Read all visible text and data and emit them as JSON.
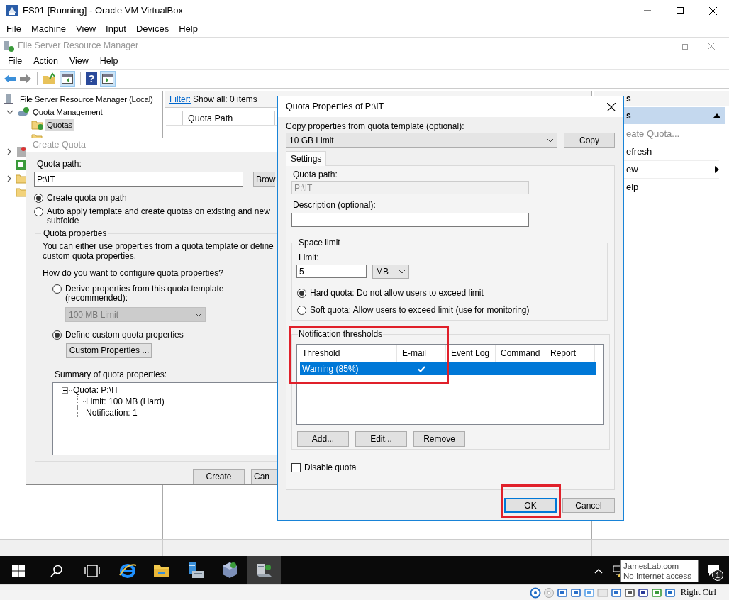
{
  "vbox": {
    "title": "FS01 [Running] - Oracle VM VirtualBox",
    "menu": [
      "File",
      "Machine",
      "View",
      "Input",
      "Devices",
      "Help"
    ],
    "host_key": "Right Ctrl"
  },
  "fsrm": {
    "title": "File Server Resource Manager",
    "menu": [
      "File",
      "Action",
      "View",
      "Help"
    ],
    "help_glyph": "?",
    "tree": [
      {
        "label": "File Server Resource Manager (Local)",
        "selected": false,
        "children": [
          {
            "label": "Quota Management",
            "expanded": true,
            "selected": false,
            "children": [
              {
                "label": "Quotas",
                "selected": true
              }
            ]
          }
        ]
      }
    ],
    "filter": {
      "link": "Filter:",
      "text": "Show all: 0 items"
    },
    "columns": [
      "Quota Path"
    ],
    "actions": {
      "header": "s",
      "section": "s",
      "items": [
        {
          "label": "eate Quota...",
          "disabled": true,
          "submenu": false
        },
        {
          "label": "efresh",
          "disabled": false,
          "submenu": false
        },
        {
          "label": "ew",
          "disabled": false,
          "submenu": true
        },
        {
          "label": "elp",
          "disabled": false,
          "submenu": false
        }
      ]
    }
  },
  "create_quota": {
    "title": "Create Quota",
    "path_label": "Quota path:",
    "path": "P:\\IT",
    "browse": "Brow",
    "modes": [
      {
        "label": "Create quota on path",
        "selected": true
      },
      {
        "label": "Auto apply template and create quotas on existing and new subfolde",
        "selected": false
      }
    ],
    "group": "Quota properties",
    "intro": "You can either use properties from a quota template or define custom quota properties.",
    "question": "How do you want to configure quota properties?",
    "sources": [
      {
        "label": "Derive properties from this quota template (recommended):",
        "selected": false
      },
      {
        "label": "Define custom quota properties",
        "selected": true
      }
    ],
    "template": "100 MB Limit",
    "template_disabled": true,
    "custom_button": "Custom Properties ...",
    "summary_label": "Summary of quota properties:",
    "summary": {
      "label": "Quota: P:\\IT",
      "expanded": true,
      "children": [
        "Limit: 100 MB (Hard)",
        "Notification: 1"
      ]
    },
    "buttons": [
      "Create",
      "Can"
    ]
  },
  "quota_properties": {
    "title": "Quota Properties of P:\\IT",
    "copy_label": "Copy properties from quota template (optional):",
    "template": "10 GB Limit",
    "copy_button": "Copy",
    "tabs": [
      {
        "label": "Settings",
        "selected": true
      }
    ],
    "path_label": "Quota path:",
    "path": "P:\\IT",
    "description_label": "Description (optional):",
    "space_group": "Space limit",
    "limit_label": "Limit:",
    "limit": "5",
    "unit": "MB",
    "limit_types": [
      {
        "label": "Hard quota: Do not allow users to exceed limit",
        "selected": true
      },
      {
        "label": "Soft quota: Allow users to exceed limit (use for monitoring)",
        "selected": false
      }
    ],
    "notify_group": "Notification thresholds",
    "columns": [
      "Threshold",
      "E-mail",
      "Event Log",
      "Command",
      "Report"
    ],
    "thresholds": [
      {
        "threshold": "Warning (85%)",
        "email": true,
        "event_log": false,
        "command": false,
        "report": false,
        "selected": true
      }
    ],
    "list_buttons": [
      "Add...",
      "Edit...",
      "Remove"
    ],
    "disable": {
      "label": "Disable quota",
      "checked": false
    },
    "buttons": [
      {
        "label": "OK",
        "default": true
      },
      {
        "label": "Cancel",
        "default": false
      }
    ]
  },
  "taskbar": {
    "apps": [
      {
        "kind": "browser",
        "running": true,
        "active": false
      },
      {
        "kind": "folder",
        "running": true,
        "active": false
      },
      {
        "kind": "server",
        "running": true,
        "active": false
      },
      {
        "kind": "cube",
        "running": false,
        "active": false
      },
      {
        "kind": "fsrm",
        "running": true,
        "active": true
      }
    ],
    "tooltip": [
      "JamesLab.com",
      "No Internet access"
    ],
    "notifications": "1"
  }
}
